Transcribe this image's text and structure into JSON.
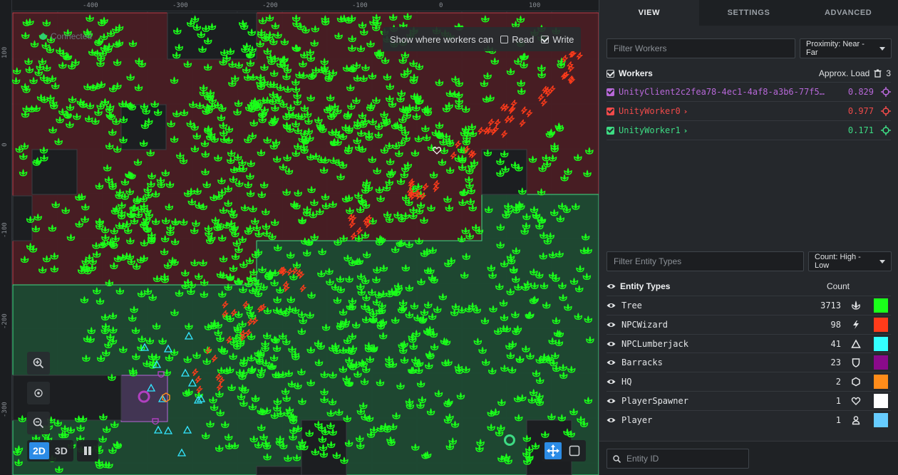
{
  "map": {
    "ruler_x": [
      "-400",
      "-300",
      "-200",
      "-100",
      "0",
      "100"
    ],
    "ruler_y": [
      "100",
      "0",
      "-100",
      "-200",
      "-300"
    ],
    "connection_label": "Connected",
    "workers_can": {
      "label": "Show where workers can",
      "read_label": "Read",
      "read_checked": false,
      "write_label": "Write",
      "write_checked": true
    },
    "mode_2d": "2D",
    "mode_3d": "3D",
    "colors": {
      "tree": "#1aff1a",
      "wizard": "#ff3b1a",
      "lumberjack": "#33e6ff",
      "barracks": "#b040c0",
      "hq": "#ff8c1a",
      "red_region": "#4a1e24",
      "green_region": "#1f4a33"
    }
  },
  "panel": {
    "tabs": [
      {
        "label": "VIEW",
        "active": true
      },
      {
        "label": "SETTINGS",
        "active": false
      },
      {
        "label": "ADVANCED",
        "active": false
      }
    ],
    "workers_filter_placeholder": "Filter Workers",
    "workers_sort": "Proximity: Near - Far",
    "workers_header": {
      "title": "Workers",
      "load_label": "Approx. Load",
      "count": "3"
    },
    "workers": [
      {
        "name": "UnityClient2c2fea78-4ec1-4af8-a3b6-77f5f…",
        "load": "0.829",
        "color": "#b768d8",
        "chevron": ""
      },
      {
        "name": "UnityWorker0",
        "load": "0.977",
        "color": "#f04a4a",
        "chevron": "›"
      },
      {
        "name": "UnityWorker1",
        "load": "0.171",
        "color": "#3ddc84",
        "chevron": "›"
      }
    ],
    "entity_filter_placeholder": "Filter Entity Types",
    "entity_sort": "Count: High - Low",
    "entity_header": {
      "title": "Entity Types",
      "count_label": "Count"
    },
    "entity_types": [
      {
        "name": "Tree",
        "count": "3713",
        "icon": "tree-icon",
        "color": "#1aff1a"
      },
      {
        "name": "NPCWizard",
        "count": "98",
        "icon": "bolt-icon",
        "color": "#ff3b1a"
      },
      {
        "name": "NPCLumberjack",
        "count": "41",
        "icon": "triangle-icon",
        "color": "#33ffff"
      },
      {
        "name": "Barracks",
        "count": "23",
        "icon": "shield-icon",
        "color": "#8a0a8a"
      },
      {
        "name": "HQ",
        "count": "2",
        "icon": "hexagon-icon",
        "color": "#ff8c1a"
      },
      {
        "name": "PlayerSpawner",
        "count": "1",
        "icon": "heart-icon",
        "color": "#ffffff"
      },
      {
        "name": "Player",
        "count": "1",
        "icon": "person-icon",
        "color": "#66ccff"
      }
    ],
    "entity_id_placeholder": "Entity ID"
  }
}
